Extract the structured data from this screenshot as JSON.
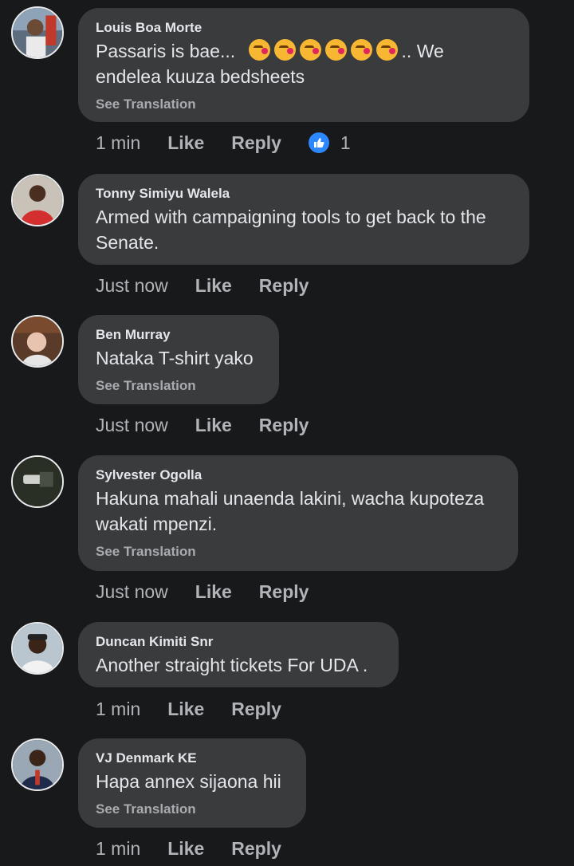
{
  "comments": [
    {
      "author": "Louis Boa Morte",
      "text_before": "Passaris is bae...",
      "text_after": ".. We endelea kuuza bedsheets",
      "translation": "See Translation",
      "time": "1 min",
      "like": "Like",
      "reply": "Reply",
      "reaction_count": "1",
      "emoji_count": 6
    },
    {
      "author": "Tonny Simiyu Walela",
      "text": "Armed with campaigning tools to get back to the Senate.",
      "time": "Just now",
      "like": "Like",
      "reply": "Reply"
    },
    {
      "author": "Ben Murray",
      "text": "Nataka T-shirt yako",
      "translation": "See Translation",
      "time": "Just now",
      "like": "Like",
      "reply": "Reply"
    },
    {
      "author": "Sylvester Ogolla",
      "text": "Hakuna mahali unaenda lakini, wacha kupoteza wakati mpenzi.",
      "translation": "See Translation",
      "time": "Just now",
      "like": "Like",
      "reply": "Reply"
    },
    {
      "author": "Duncan Kimiti Snr",
      "text": "Another straight tickets For UDA .",
      "time": "1 min",
      "like": "Like",
      "reply": "Reply"
    },
    {
      "author": "VJ Denmark KE",
      "text": "Hapa annex sijaona hii",
      "translation": "See Translation",
      "time": "1 min",
      "like": "Like",
      "reply": "Reply"
    }
  ],
  "colors": {
    "background": "#18191a",
    "bubble": "#3a3b3c",
    "like_blue": "#2d88ff"
  },
  "icons": {
    "reaction": "thumbs-up-icon",
    "emoji": "kissing-face-emoji-icon"
  }
}
